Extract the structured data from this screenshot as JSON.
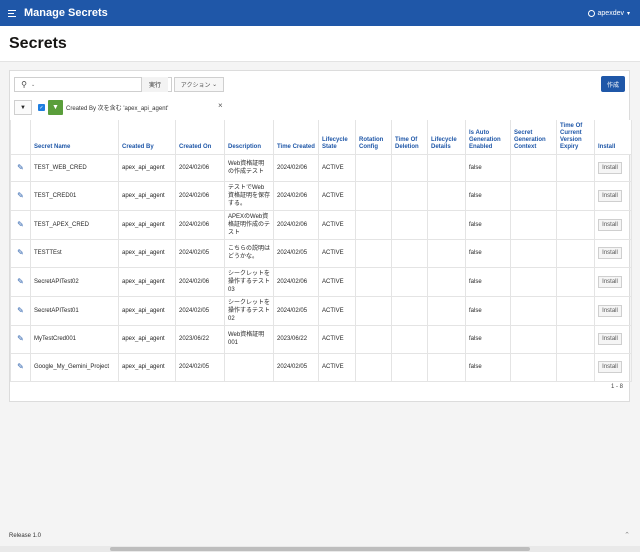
{
  "header": {
    "app_title": "Manage Secrets",
    "username": "apexdev"
  },
  "page": {
    "title": "Secrets"
  },
  "toolbar": {
    "search_placeholder": "",
    "go_label": "実行",
    "actions_label": "アクション",
    "create_label": "作成"
  },
  "filter": {
    "label": "Created By 次を含む 'apex_api_agent'"
  },
  "table": {
    "columns": [
      "Secret Name",
      "Created By",
      "Created On",
      "Description",
      "Time Created",
      "Lifecycle State",
      "Rotation Config",
      "Time Of Deletion",
      "Lifecycle Details",
      "Is Auto Generation Enabled",
      "Secret Generation Context",
      "Time Of Current Version Expiry",
      "Install"
    ],
    "rows": [
      {
        "name": "TEST_WEB_CRED",
        "created_by": "apex_api_agent",
        "created_on": "2024/02/06",
        "description": "Web資格証明の作成テスト",
        "time_created": "2024/02/06",
        "state": "ACTIVE",
        "auto": "false",
        "install": "Install"
      },
      {
        "name": "TEST_CRED01",
        "created_by": "apex_api_agent",
        "created_on": "2024/02/06",
        "description": "テストでWeb資格証明を保存する。",
        "time_created": "2024/02/06",
        "state": "ACTIVE",
        "auto": "false",
        "install": "Install"
      },
      {
        "name": "TEST_APEX_CRED",
        "created_by": "apex_api_agent",
        "created_on": "2024/02/06",
        "description": "APEXのWeb資格証明作成のテスト",
        "time_created": "2024/02/06",
        "state": "ACTIVE",
        "auto": "false",
        "install": "Install"
      },
      {
        "name": "TESTTEst",
        "created_by": "apex_api_agent",
        "created_on": "2024/02/05",
        "description": "こちらの説明はどうかな。",
        "time_created": "2024/02/05",
        "state": "ACTIVE",
        "auto": "false",
        "install": "Install"
      },
      {
        "name": "SecretAPITest02",
        "created_by": "apex_api_agent",
        "created_on": "2024/02/06",
        "description": "シークレットを操作するテスト03",
        "time_created": "2024/02/06",
        "state": "ACTIVE",
        "auto": "false",
        "install": "Install"
      },
      {
        "name": "SecretAPITest01",
        "created_by": "apex_api_agent",
        "created_on": "2024/02/05",
        "description": "シークレットを操作するテスト02",
        "time_created": "2024/02/05",
        "state": "ACTIVE",
        "auto": "false",
        "install": "Install"
      },
      {
        "name": "MyTestCred001",
        "created_by": "apex_api_agent",
        "created_on": "2023/06/22",
        "description": "Web資格証明001",
        "time_created": "2023/06/22",
        "state": "ACTIVE",
        "auto": "false",
        "install": "Install"
      },
      {
        "name": "Google_My_Gemini_Project",
        "created_by": "apex_api_agent",
        "created_on": "2024/02/05",
        "description": "",
        "time_created": "2024/02/05",
        "state": "ACTIVE",
        "auto": "false",
        "install": "Install"
      }
    ],
    "pagination": "1 - 8"
  },
  "footer": {
    "release": "Release 1.0"
  },
  "icons": {
    "menu": "hamburger-icon",
    "user": "user-icon",
    "search": "search-icon",
    "edit": "edit-icon",
    "filter": "filter-icon",
    "remove": "close-icon",
    "scroll_top": "chevron-up-icon"
  },
  "colors": {
    "brand": "#1f57a8",
    "filter_green": "#5a9e3b",
    "checkbox_blue": "#1f7ee0"
  }
}
